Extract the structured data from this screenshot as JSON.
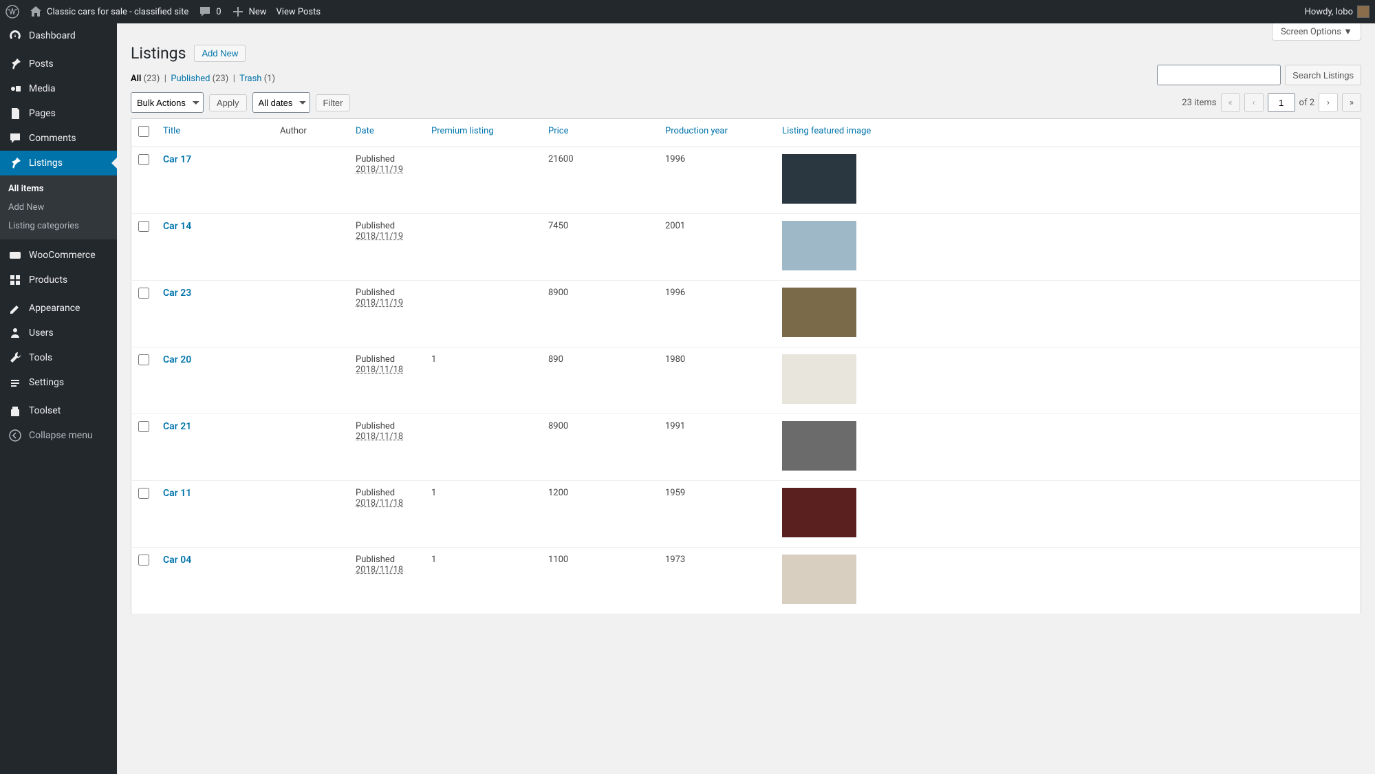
{
  "adminbar": {
    "site_title": "Classic cars for sale - classified site",
    "comments": "0",
    "new_label": "New",
    "view_posts": "View Posts",
    "howdy": "Howdy, lobo"
  },
  "sidebar": {
    "dashboard": "Dashboard",
    "posts": "Posts",
    "media": "Media",
    "pages": "Pages",
    "comments": "Comments",
    "listings": "Listings",
    "sub_all_items": "All items",
    "sub_add_new": "Add New",
    "sub_listing_categories": "Listing categories",
    "woocommerce": "WooCommerce",
    "products": "Products",
    "appearance": "Appearance",
    "users": "Users",
    "tools": "Tools",
    "settings": "Settings",
    "toolset": "Toolset",
    "collapse": "Collapse menu"
  },
  "header": {
    "screen_options": "Screen Options",
    "page_title": "Listings",
    "add_new": "Add New"
  },
  "filters": {
    "all_label": "All",
    "all_count": "(23)",
    "published_label": "Published",
    "published_count": "(23)",
    "trash_label": "Trash",
    "trash_count": "(1)",
    "bulk_actions": "Bulk Actions",
    "apply": "Apply",
    "all_dates": "All dates",
    "filter": "Filter",
    "items_label": "23 items",
    "of_pages": "of 2",
    "page_current": "1",
    "search_btn": "Search Listings"
  },
  "columns": {
    "title": "Title",
    "author": "Author",
    "date": "Date",
    "premium": "Premium listing",
    "price": "Price",
    "year": "Production year",
    "image": "Listing featured image"
  },
  "rows": [
    {
      "title": "Car 17",
      "status": "Published",
      "date": "2018/11/19",
      "premium": "",
      "price": "21600",
      "year": "1996",
      "thumb": "#2a3640"
    },
    {
      "title": "Car 14",
      "status": "Published",
      "date": "2018/11/19",
      "premium": "",
      "price": "7450",
      "year": "2001",
      "thumb": "#9fb8c8"
    },
    {
      "title": "Car 23",
      "status": "Published",
      "date": "2018/11/19",
      "premium": "",
      "price": "8900",
      "year": "1996",
      "thumb": "#7a6a4a"
    },
    {
      "title": "Car 20",
      "status": "Published",
      "date": "2018/11/18",
      "premium": "1",
      "price": "890",
      "year": "1980",
      "thumb": "#e8e6dc"
    },
    {
      "title": "Car 21",
      "status": "Published",
      "date": "2018/11/18",
      "premium": "",
      "price": "8900",
      "year": "1991",
      "thumb": "#6b6b6b"
    },
    {
      "title": "Car 11",
      "status": "Published",
      "date": "2018/11/18",
      "premium": "1",
      "price": "1200",
      "year": "1959",
      "thumb": "#5a1f1f"
    },
    {
      "title": "Car 04",
      "status": "Published",
      "date": "2018/11/18",
      "premium": "1",
      "price": "1100",
      "year": "1973",
      "thumb": "#d8cfc0"
    }
  ]
}
